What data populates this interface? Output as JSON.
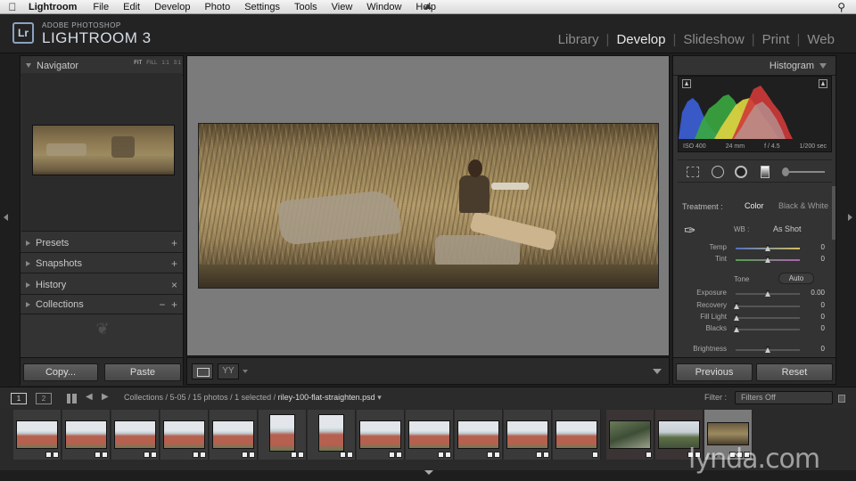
{
  "menubar": {
    "app": "Lightroom",
    "items": [
      "File",
      "Edit",
      "Develop",
      "Photo",
      "Settings",
      "Tools",
      "View",
      "Window",
      "Help"
    ]
  },
  "identity": {
    "logo": "Lr",
    "line1": "ADOBE PHOTOSHOP",
    "line2": "LIGHTROOM 3"
  },
  "modules": {
    "items": [
      "Library",
      "Develop",
      "Slideshow",
      "Print",
      "Web"
    ],
    "active": "Develop"
  },
  "left_panel": {
    "navigator": {
      "label": "Navigator",
      "zoom": [
        "FIT",
        "FILL",
        "1:1",
        "3:1"
      ]
    },
    "presets": "Presets",
    "snapshots": "Snapshots",
    "history": "History",
    "collections": "Collections",
    "copy_label": "Copy...",
    "paste_label": "Paste"
  },
  "toolbar": {
    "yy": "YY"
  },
  "right_panel": {
    "histogram_label": "Histogram",
    "info": {
      "iso": "ISO 400",
      "focal": "24 mm",
      "aperture": "f / 4.5",
      "shutter": "1/200 sec"
    },
    "treatment_label": "Treatment :",
    "treatment_color": "Color",
    "treatment_bw": "Black & White",
    "wb_label": "WB :",
    "wb_value": "As Shot",
    "sliders": [
      {
        "name": "Temp",
        "value": "0"
      },
      {
        "name": "Tint",
        "value": "0"
      },
      {
        "name": "Exposure",
        "value": "0.00"
      },
      {
        "name": "Recovery",
        "value": "0"
      },
      {
        "name": "Fill Light",
        "value": "0"
      },
      {
        "name": "Blacks",
        "value": "0"
      },
      {
        "name": "Brightness",
        "value": "0"
      }
    ],
    "tone_label": "Tone",
    "auto_label": "Auto",
    "previous_label": "Previous",
    "reset_label": "Reset"
  },
  "filmstrip_bar": {
    "screen1": "1",
    "screen2": "2",
    "breadcrumb": "Collections / 5-05 / 15 photos / 1 selected /",
    "filename": "riley-100-flat-straighten.psd",
    "filter_label": "Filter :",
    "filter_value": "Filters Off"
  },
  "filmstrip": {
    "count": 15,
    "selected_index": 14,
    "stars": "★★★"
  },
  "watermark": "lynda.com"
}
